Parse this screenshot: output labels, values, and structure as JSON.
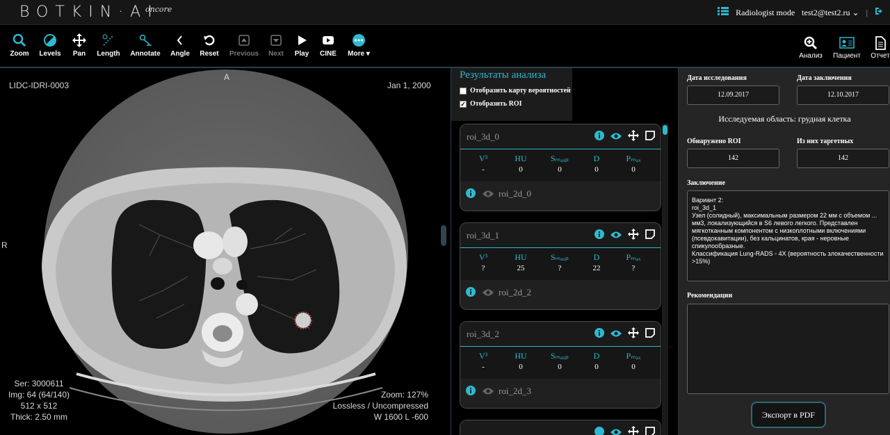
{
  "app": {
    "logo": "BOTKIN·AI",
    "logo_sub": "oncore",
    "mode": "Radiologist mode",
    "user": "test2@test2.ru",
    "separator": "|"
  },
  "toolbar": {
    "tools": [
      {
        "label": "Zoom",
        "icon": "magnifier-icon"
      },
      {
        "label": "Levels",
        "icon": "contrast-icon"
      },
      {
        "label": "Pan",
        "icon": "move-arrows-icon"
      },
      {
        "label": "Length",
        "icon": "ruler-icon"
      },
      {
        "label": "Annotate",
        "icon": "annotate-icon"
      },
      {
        "label": "Angle",
        "icon": "angle-icon"
      },
      {
        "label": "Reset",
        "icon": "reset-icon"
      },
      {
        "label": "Previous",
        "icon": "previous-icon"
      },
      {
        "label": "Next",
        "icon": "next-icon"
      },
      {
        "label": "Play",
        "icon": "play-icon"
      },
      {
        "label": "CINE",
        "icon": "cine-icon"
      },
      {
        "label": "More ▾",
        "icon": "more-icon"
      }
    ],
    "right_tools": [
      {
        "label": "Анализ",
        "icon": "analysis-search-icon"
      },
      {
        "label": "Пациент",
        "icon": "patient-card-icon"
      },
      {
        "label": "Отчет",
        "icon": "report-document-icon"
      }
    ]
  },
  "viewer": {
    "patient_id": "LIDC-IDRI-0003",
    "date": "Jan 1, 2000",
    "orientation_top": "A",
    "orientation_left": "R",
    "series": "Ser: 3000611",
    "image": "Img: 64 (64/140)",
    "matrix": "512 x 512",
    "thickness": "Thick: 2.50 mm",
    "zoom": "Zoom: 127%",
    "compression": "Lossless / Uncompressed",
    "window": "W 1600 L -600"
  },
  "results": {
    "title": "Результаты анализа",
    "show_probability_map": "Отобразить карту вероятностей",
    "show_probability_map_checked": false,
    "show_roi": "Отобразить ROI",
    "show_roi_checked": true,
    "metric_headers": [
      "V³",
      "HU",
      "Sₘₐₓₚ",
      "D",
      "Pₘₐₓ"
    ],
    "rois": [
      {
        "name": "roi_3d_0",
        "values": [
          "-",
          "0",
          "0",
          "0",
          "0"
        ],
        "sub": "roi_2d_0"
      },
      {
        "name": "roi_3d_1",
        "values": [
          "?",
          "25",
          "?",
          "22",
          "?"
        ],
        "sub": "roi_2d_2"
      },
      {
        "name": "roi_3d_2",
        "values": [
          "-",
          "0",
          "0",
          "0",
          "0"
        ],
        "sub": "roi_2d_3"
      }
    ]
  },
  "report": {
    "study_date_label": "Дата исследования",
    "study_date": "12.09.2017",
    "conclusion_date_label": "Дата заключения",
    "conclusion_date": "12.10.2017",
    "area": "Исследуемая область: грудная клетка",
    "roi_found_label": "Обнаружено ROI",
    "roi_found": "142",
    "targeted_label": "Из них таргетных",
    "targeted": "142",
    "conclusion_label": "Заключение",
    "conclusion_text": "Вариант 2:\nroi_3d_1\nУзел (солидный), максимальным размером 22 мм с объемом ... мм3, локализующийся в S6 левого легкого. Представлен мягкотканным компонентом с низкоплотными включениями (псевдокавитации), без кальцинатов, края - неровные спикулообразные.\nКлассификация Lung-RADS - 4X (вероятность злокачественности >15%)",
    "recommendations_label": "Рекомендации",
    "recommendations_text": "",
    "export_label": "Экспорт в PDF"
  }
}
